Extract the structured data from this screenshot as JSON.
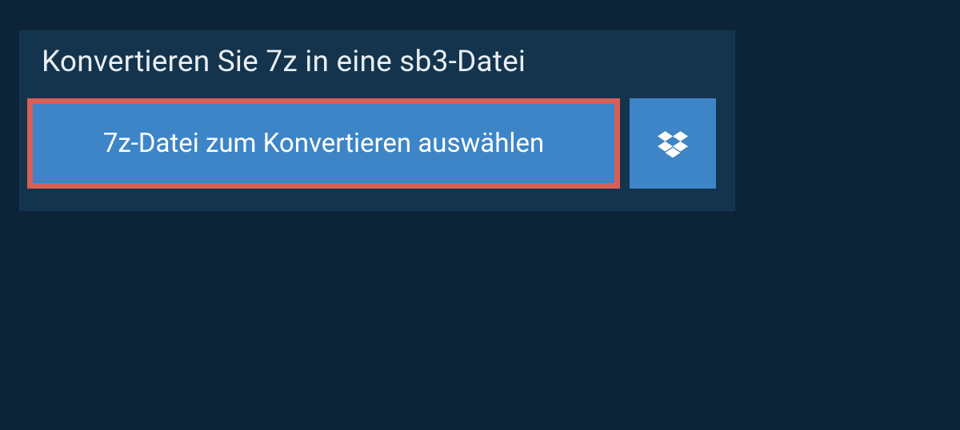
{
  "title": "Konvertieren Sie 7z in eine sb3-Datei",
  "buttons": {
    "select_file_label": "7z-Datei zum Konvertieren auswählen"
  },
  "colors": {
    "background": "#0d2438",
    "panel": "#14344d",
    "button_primary": "#3d85c6",
    "highlight_border": "#d85f56",
    "text_light": "#ffffff"
  }
}
